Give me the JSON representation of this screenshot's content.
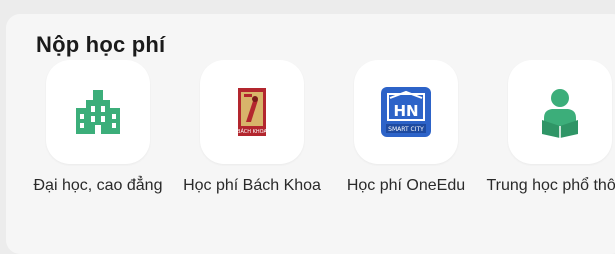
{
  "section": {
    "title": "Nộp học phí"
  },
  "colors": {
    "accent_green": "#3cae7a",
    "bk_red": "#b3262e",
    "oneedu_blue": "#2d63c8"
  },
  "items": [
    {
      "label": "Đại học, cao đẳng",
      "icon": "university-building-icon"
    },
    {
      "label": "Học phí Bách Khoa",
      "icon": "bach-khoa-logo-icon",
      "icon_text": "BÁCH KHOA"
    },
    {
      "label": "Học phí OneEdu",
      "icon": "oneedu-smart-city-icon",
      "icon_text": "SMART CITY"
    },
    {
      "label": "Trung học phổ thông",
      "icon": "student-reading-icon"
    }
  ]
}
